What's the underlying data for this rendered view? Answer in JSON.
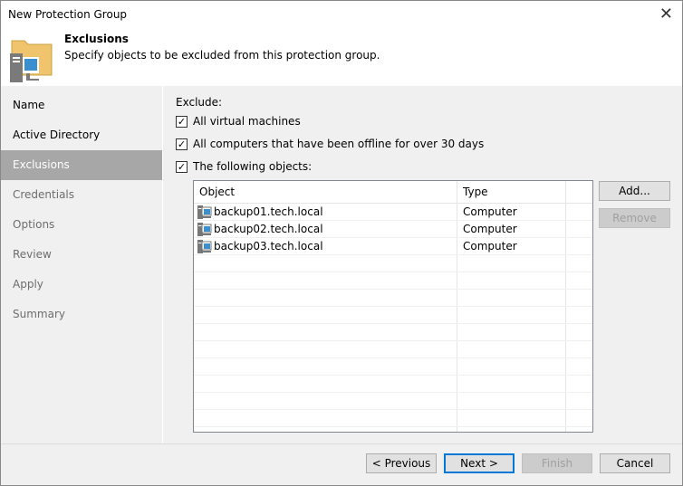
{
  "window": {
    "title": "New Protection Group"
  },
  "header": {
    "title": "Exclusions",
    "subtitle": "Specify objects to be excluded from this protection group."
  },
  "nav": {
    "items": [
      {
        "label": "Name",
        "state": "done"
      },
      {
        "label": "Active Directory",
        "state": "done"
      },
      {
        "label": "Exclusions",
        "state": "selected"
      },
      {
        "label": "Credentials",
        "state": "disabled"
      },
      {
        "label": "Options",
        "state": "disabled"
      },
      {
        "label": "Review",
        "state": "disabled"
      },
      {
        "label": "Apply",
        "state": "disabled"
      },
      {
        "label": "Summary",
        "state": "disabled"
      }
    ]
  },
  "main": {
    "exclude_label": "Exclude:",
    "checkboxes": [
      {
        "label": "All virtual machines",
        "checked": true
      },
      {
        "label": "All computers that have been offline for over 30 days",
        "checked": true
      },
      {
        "label": "The following objects:",
        "checked": true
      }
    ],
    "table": {
      "columns": [
        "Object",
        "Type"
      ],
      "rows": [
        {
          "object": "backup01.tech.local",
          "type": "Computer"
        },
        {
          "object": "backup02.tech.local",
          "type": "Computer"
        },
        {
          "object": "backup03.tech.local",
          "type": "Computer"
        }
      ]
    },
    "add_label": "Add...",
    "remove_label": "Remove"
  },
  "footer": {
    "previous": "< Previous",
    "next": "Next >",
    "finish": "Finish",
    "cancel": "Cancel"
  }
}
